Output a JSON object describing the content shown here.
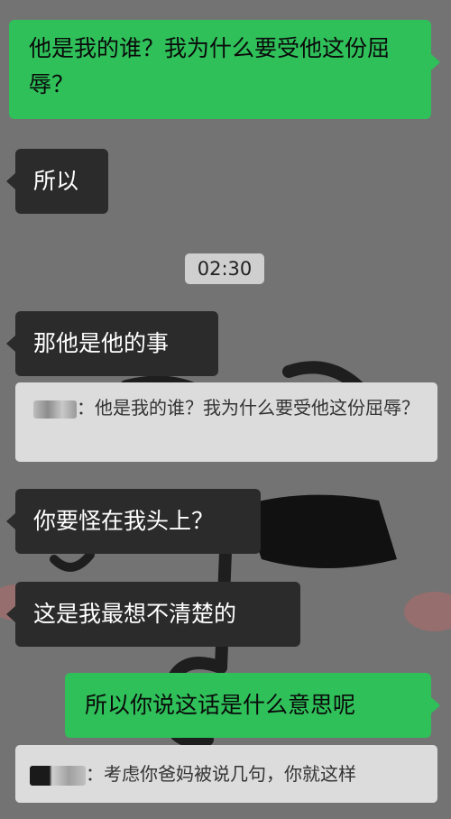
{
  "messages": {
    "m1": "他是我的谁？我为什么要受他这份屈辱？",
    "m2": "所以",
    "time": "02:30",
    "m3": "那他是他的事",
    "quote1_sep": "：",
    "quote1": "他是我的谁？我为什么要受他这份屈辱？",
    "m4": "你要怪在我头上？",
    "m5": "这是我最想不清楚的",
    "m6": "所以你说这话是什么意思呢",
    "quote2_sep": "：",
    "quote2": "考虑你爸妈被说几句，你就这样"
  },
  "colors": {
    "background": "#737373",
    "sent_bubble": "#2fc05a",
    "received_bubble": "#2b2b2b",
    "quote_bg": "#dcdcdc"
  }
}
